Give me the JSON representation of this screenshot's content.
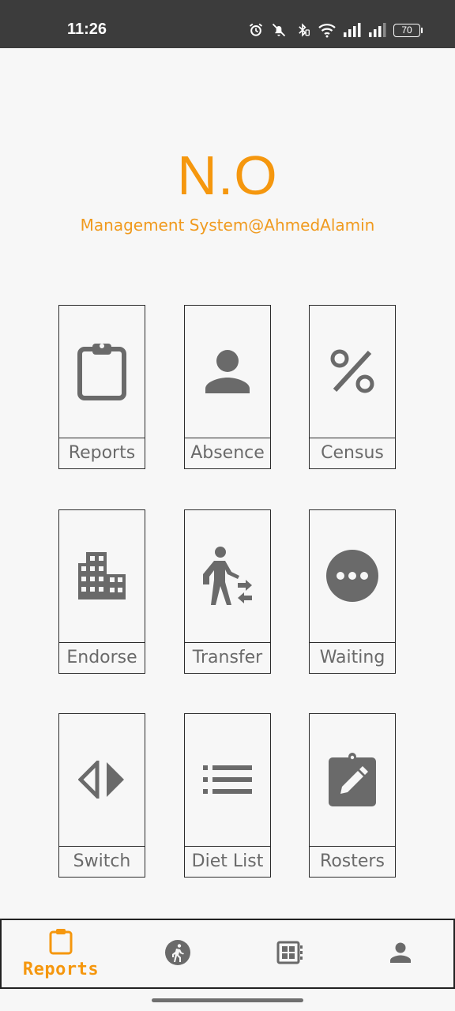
{
  "status_bar": {
    "time": "11:26",
    "battery": "70",
    "icons": [
      "alarm-icon",
      "mute-icon",
      "bluetooth-icon",
      "wifi-icon",
      "signal-icon",
      "signal-icon-2",
      "battery-icon"
    ]
  },
  "header": {
    "title": "N.O",
    "subtitle": "Management System@AhmedAlamin"
  },
  "tiles": [
    {
      "label": "Reports",
      "icon": "clipboard-icon"
    },
    {
      "label": "Absence",
      "icon": "person-icon"
    },
    {
      "label": "Census",
      "icon": "percent-icon"
    },
    {
      "label": "Endorse",
      "icon": "building-icon"
    },
    {
      "label": "Transfer",
      "icon": "transfer-walk-icon"
    },
    {
      "label": "Waiting",
      "icon": "more-horizontal-icon"
    },
    {
      "label": "Switch",
      "icon": "compare-arrows-icon"
    },
    {
      "label": "Diet List",
      "icon": "list-icon"
    },
    {
      "label": "Rosters",
      "icon": "edit-clipboard-icon"
    }
  ],
  "bottom_nav": {
    "items": [
      {
        "label": "Reports",
        "icon": "clipboard-icon",
        "active": true
      },
      {
        "label": "",
        "icon": "running-icon",
        "active": false
      },
      {
        "label": "",
        "icon": "calendar-grid-icon",
        "active": false
      },
      {
        "label": "",
        "icon": "person-icon",
        "active": false
      }
    ]
  },
  "colors": {
    "accent": "#f5970e",
    "icon_gray": "#6a6a6a",
    "status_bar": "#3c3c3c",
    "background": "#f7f7f7"
  }
}
